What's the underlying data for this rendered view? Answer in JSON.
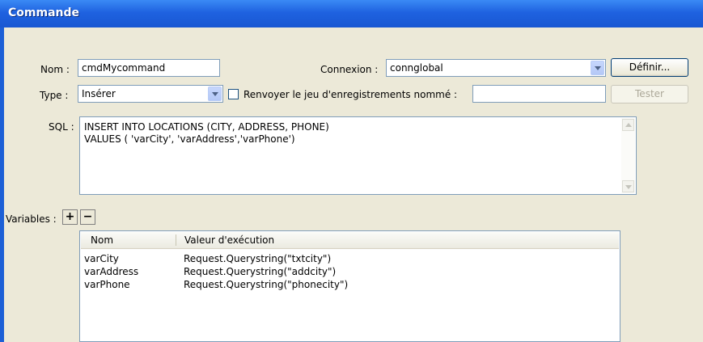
{
  "window": {
    "title": "Commande"
  },
  "form": {
    "nom_label": "Nom :",
    "nom_value": "cmdMycommand",
    "connexion_label": "Connexion :",
    "connexion_value": "connglobal",
    "definir_label": "Définir...",
    "type_label": "Type :",
    "type_value": "Insérer",
    "renvoyer_label": "Renvoyer le jeu d'enregistrements nommé :",
    "renvoyer_value": "",
    "tester_label": "Tester",
    "sql_label": "SQL :",
    "sql_lines": [
      "INSERT INTO  LOCATIONS (CITY, ADDRESS, PHONE)",
      "VALUES ( 'varCity', 'varAddress','varPhone')"
    ],
    "variables_label": "Variables :",
    "add_label": "+",
    "remove_label": "−"
  },
  "variables_table": {
    "columns": [
      "Nom",
      "Valeur d'exécution"
    ],
    "rows": [
      [
        "varCity",
        "Request.Querystring(\"txtcity\")"
      ],
      [
        "varAddress",
        "Request.Querystring(\"addcity\")"
      ],
      [
        "varPhone",
        "Request.Querystring(\"phonecity\")"
      ]
    ]
  },
  "colors": {
    "titlebar": "#1f62e0",
    "dialog_bg": "#ece9d8",
    "field_border": "#7f9db9"
  }
}
